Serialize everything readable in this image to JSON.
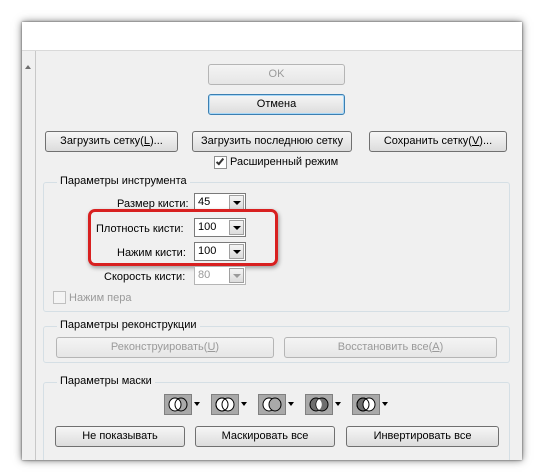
{
  "dialog": {
    "ok_label": "OK",
    "cancel_label": "Отмена",
    "load_mesh_label": "Загрузить сетку(L)...",
    "load_last_mesh_label": "Загрузить последнюю сетку",
    "save_mesh_label": "Сохранить сетку(V)...",
    "advanced_mode_label": "Расширенный режим",
    "advanced_mode_checked": true
  },
  "tool_options": {
    "title": "Параметры инструмента",
    "brush_size": {
      "label": "Размер кисти:",
      "value": "45"
    },
    "brush_density": {
      "label": "Плотность кисти:",
      "value": "100"
    },
    "brush_pressure": {
      "label": "Нажим кисти:",
      "value": "100"
    },
    "brush_rate": {
      "label": "Скорость кисти:",
      "value": "80",
      "disabled": true
    },
    "stylus_pressure": {
      "label": "Нажим пера",
      "checked": false,
      "disabled": true
    }
  },
  "reconstruct_options": {
    "title": "Параметры реконструкции",
    "reconstruct_label": "Реконструировать(U)",
    "restore_all_label": "Восстановить все(A)"
  },
  "mask_options": {
    "title": "Параметры маски",
    "mask_modes": [
      "replace-selection",
      "add-to-selection",
      "subtract-from-selection",
      "intersect-with-selection",
      "invert-selection"
    ],
    "none_label": "Не показывать",
    "mask_all_label": "Маскировать все",
    "invert_all_label": "Инвертировать все"
  },
  "colors": {
    "highlight": "#d82020",
    "dialog_bg": "#f0f0f0"
  }
}
